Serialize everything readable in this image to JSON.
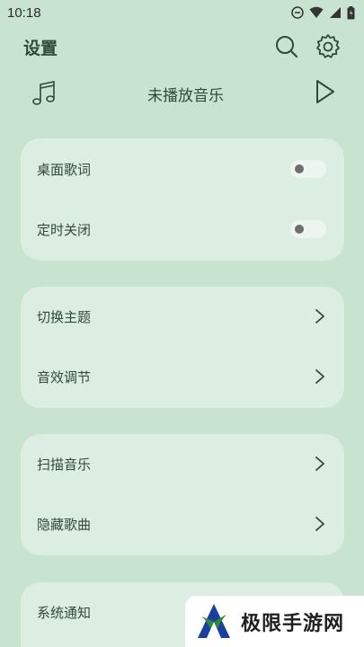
{
  "status": {
    "time": "10:18"
  },
  "header": {
    "title": "设置"
  },
  "player": {
    "now_playing": "未播放音乐"
  },
  "cards": [
    {
      "rows": [
        {
          "label": "桌面歌词",
          "control": "toggle",
          "enabled": false
        },
        {
          "label": "定时关闭",
          "control": "toggle",
          "enabled": false
        }
      ]
    },
    {
      "rows": [
        {
          "label": "切换主题",
          "control": "chevron"
        },
        {
          "label": "音效调节",
          "control": "chevron"
        }
      ]
    },
    {
      "rows": [
        {
          "label": "扫描音乐",
          "control": "chevron"
        },
        {
          "label": "隐藏歌曲",
          "control": "chevron"
        }
      ]
    },
    {
      "rows": [
        {
          "label": "系统通知",
          "control": "toggle",
          "enabled": false
        }
      ]
    }
  ],
  "watermark": {
    "text": "极限手游网"
  },
  "colors": {
    "background": "#c9e3d1",
    "card": "#dcede1",
    "text": "#2f4a3a",
    "watermark_green": "#2e8b3a",
    "watermark_blue": "#1a3fa0"
  },
  "icons": [
    "search-icon",
    "settings-gear-icon",
    "music-note-icon",
    "play-icon",
    "chevron-right-icon"
  ]
}
